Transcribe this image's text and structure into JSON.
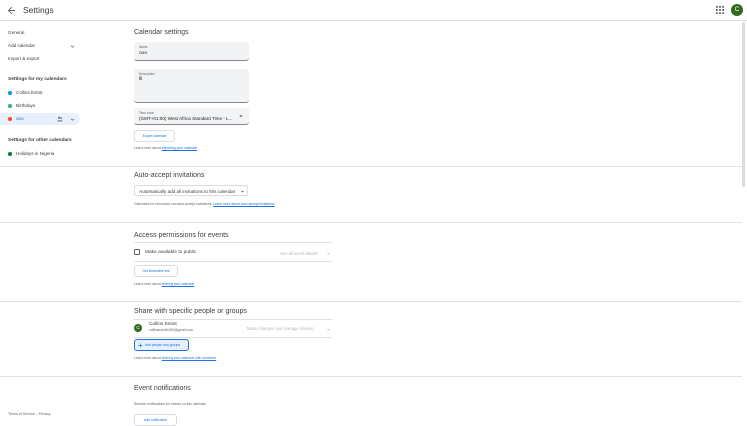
{
  "header": {
    "title": "Settings",
    "avatar_letter": "C"
  },
  "sidebar": {
    "general": "General",
    "add_calendar": "Add calendar",
    "import_export": "Import & export",
    "my_calendars_heading": "Settings for my calendars",
    "my_calendars": [
      {
        "name": "Collins Estiot",
        "color": "#039be5"
      },
      {
        "name": "Birthdays",
        "color": "#33b679"
      },
      {
        "name": "ooo",
        "color": "#f4511e",
        "selected": true
      }
    ],
    "other_calendars_heading": "Settings for other calendars",
    "other_calendars": [
      {
        "name": "Holidays in Nigeria",
        "color": "#0b8043"
      }
    ],
    "footer": "Terms of Service – Privacy"
  },
  "calendar_settings": {
    "title": "Calendar settings",
    "name_label": "Name",
    "name_value": "ooo",
    "description_label": "Description",
    "description_value": "lll",
    "timezone_label": "Time zone",
    "timezone_value": "(GMT+01:00) West Africa Standard Time - L...",
    "export_button": "Export calendar",
    "learn_prefix": "Learn more about ",
    "learn_link": "exporting your calendar"
  },
  "auto_accept": {
    "title": "Auto-accept invitations",
    "select_value": "Automatically add all invitations to this calendar",
    "note": "Calendars for resources can auto-accept invitations. ",
    "note_link": "Learn more about auto-accept invitations"
  },
  "access": {
    "title": "Access permissions for events",
    "make_public": "Make available to public",
    "detail_select": "See all event details",
    "share_link_button": "Get shareable link",
    "learn_prefix": "Learn more about ",
    "learn_link": "sharing your calendar"
  },
  "share": {
    "title": "Share with specific people or groups",
    "person_name": "Collins Estiot",
    "person_email": "collinsestiot0150@gmail.com",
    "person_initial": "C",
    "permission": "Make changes and manage sharing",
    "add_button": "Add people and groups",
    "learn_prefix": "Learn more about ",
    "learn_link": "sharing your calendar with someone"
  },
  "event_notifications": {
    "title": "Event notifications",
    "subtitle": "Receive notifications for events on this calendar",
    "add_button": "Add notification"
  },
  "colors": {
    "accent": "#1a73e8",
    "selected_bg": "#e8f0fe",
    "avatar": "#33691e"
  }
}
